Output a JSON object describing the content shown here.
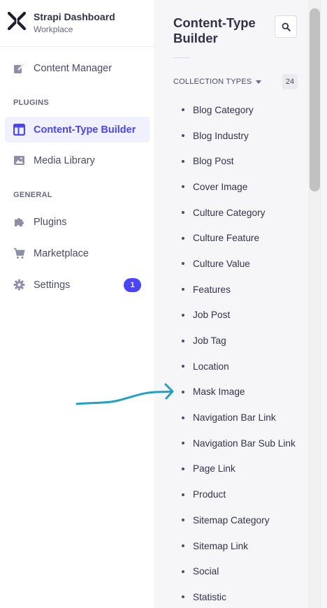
{
  "brand": {
    "title": "Strapi Dashboard",
    "subtitle": "Workplace"
  },
  "nav": {
    "content_manager": "Content Manager",
    "plugins_section": "PLUGINS",
    "content_type_builder": "Content-Type Builder",
    "media_library": "Media Library",
    "general_section": "GENERAL",
    "plugins": "Plugins",
    "marketplace": "Marketplace",
    "settings": "Settings",
    "settings_badge": "1"
  },
  "sub_nav": {
    "title": "Content-Type Builder",
    "collection_header": "COLLECTION TYPES",
    "collection_count": "24",
    "items": [
      "Blog Category",
      "Blog Industry",
      "Blog Post",
      "Cover Image",
      "Culture Category",
      "Culture Feature",
      "Culture Value",
      "Features",
      "Job Post",
      "Job Tag",
      "Location",
      "Mask Image",
      "Navigation Bar Link",
      "Navigation Bar Sub Link",
      "Page Link",
      "Product",
      "Sitemap Category",
      "Sitemap Link",
      "Social",
      "Statistic"
    ]
  },
  "colors": {
    "accent": "#4945ff",
    "active_bg": "#f0f0ff",
    "annotation": "#1fa2c2"
  },
  "icons": {
    "logo": "strapi-logo",
    "content_manager": "pen-to-square-icon",
    "content_type_builder": "layout-icon",
    "media_library": "image-icon",
    "plugins": "puzzle-icon",
    "marketplace": "cart-icon",
    "settings": "gear-icon",
    "search": "search-icon"
  }
}
